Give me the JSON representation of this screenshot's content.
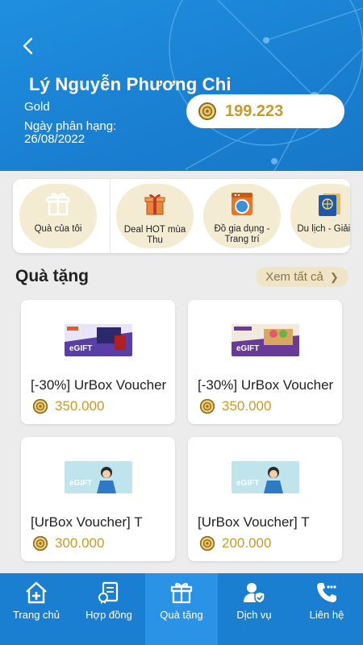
{
  "header": {
    "name": "Lý Nguyễn Phương Chi",
    "tier": "Gold",
    "rank_label": "Ngày phân hạng:",
    "rank_date": "26/08/2022",
    "points": "199.223",
    "accent": "#1a7fd1",
    "gold": "#c79a2a"
  },
  "categories": [
    {
      "label": "Quà của tôi",
      "icon": "gift-outline-icon"
    },
    {
      "label": "Deal HOT mùa Thu",
      "icon": "gift-box-icon"
    },
    {
      "label": "Đồ gia dụng - Trang trí",
      "icon": "washing-machine-icon"
    },
    {
      "label": "Du lịch - Giải trí",
      "icon": "passport-icon"
    }
  ],
  "section": {
    "title": "Quà tặng",
    "see_all": "Xem tất cả"
  },
  "gifts": [
    {
      "title": "[-30%] UrBox Voucher",
      "price": "350.000",
      "thumb_text": "eGIFT"
    },
    {
      "title": "[-30%] UrBox Voucher",
      "price": "350.000",
      "thumb_text": "eGIFT"
    },
    {
      "title": "[UrBox Voucher] T",
      "price": "300.000",
      "thumb_text": "eGIFT"
    },
    {
      "title": "[UrBox Voucher] T",
      "price": "200.000",
      "thumb_text": "eGIFT"
    }
  ],
  "nav": [
    {
      "label": "Trang chủ",
      "icon": "home-icon",
      "active": false
    },
    {
      "label": "Hợp đồng",
      "icon": "contract-icon",
      "active": false
    },
    {
      "label": "Quà tặng",
      "icon": "gift-icon",
      "active": true
    },
    {
      "label": "Dịch vụ",
      "icon": "user-shield-icon",
      "active": false
    },
    {
      "label": "Liên hệ",
      "icon": "phone-icon",
      "active": false
    }
  ]
}
